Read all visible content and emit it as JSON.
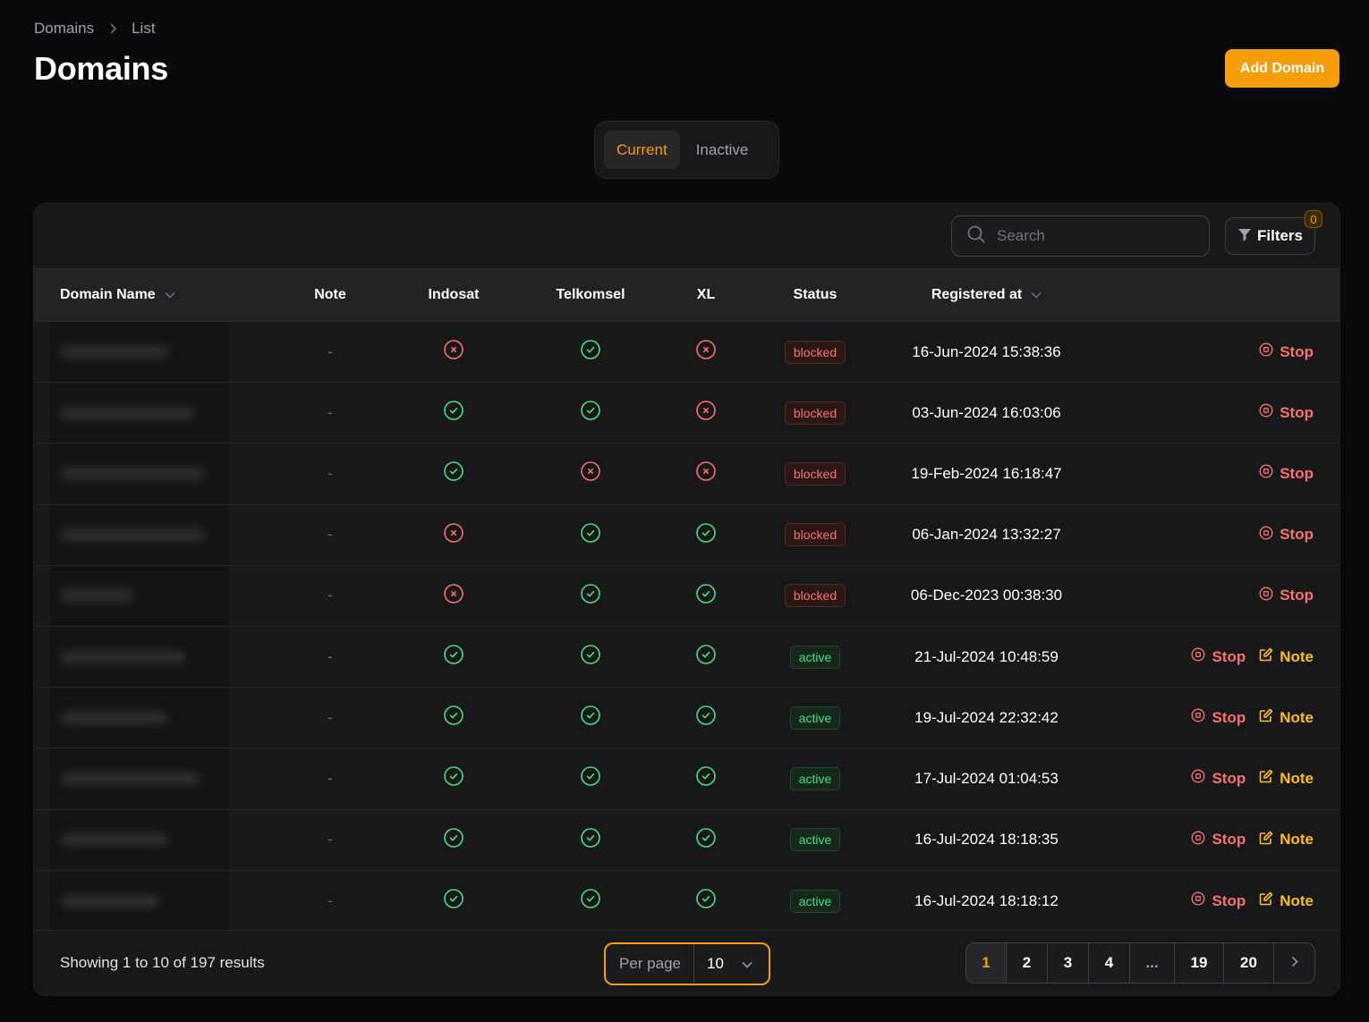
{
  "breadcrumb": {
    "items": [
      "Domains",
      "List"
    ]
  },
  "page": {
    "title": "Domains",
    "add_button": "Add Domain"
  },
  "tabs": [
    {
      "label": "Current",
      "active": true
    },
    {
      "label": "Inactive",
      "active": false
    }
  ],
  "toolbar": {
    "search_placeholder": "Search",
    "search_value": "",
    "filters_label": "Filters",
    "filters_count": "0"
  },
  "table": {
    "columns": [
      "Domain Name",
      "Note",
      "Indosat",
      "Telkomsel",
      "XL",
      "Status",
      "Registered at"
    ],
    "rows": [
      {
        "domain": "[redacted]",
        "note": "-",
        "indosat": false,
        "telkomsel": true,
        "xl": false,
        "status": "blocked",
        "registered_at": "16-Jun-2024 15:38:36",
        "actions": [
          "Stop"
        ]
      },
      {
        "domain": "[redacted]",
        "note": "-",
        "indosat": true,
        "telkomsel": true,
        "xl": false,
        "status": "blocked",
        "registered_at": "03-Jun-2024 16:03:06",
        "actions": [
          "Stop"
        ]
      },
      {
        "domain": "[redacted]",
        "note": "-",
        "indosat": true,
        "telkomsel": false,
        "xl": false,
        "status": "blocked",
        "registered_at": "19-Feb-2024 16:18:47",
        "actions": [
          "Stop"
        ]
      },
      {
        "domain": "[redacted]",
        "note": "-",
        "indosat": false,
        "telkomsel": true,
        "xl": true,
        "status": "blocked",
        "registered_at": "06-Jan-2024 13:32:27",
        "actions": [
          "Stop"
        ]
      },
      {
        "domain": "[redacted]",
        "note": "-",
        "indosat": false,
        "telkomsel": true,
        "xl": true,
        "status": "blocked",
        "registered_at": "06-Dec-2023 00:38:30",
        "actions": [
          "Stop"
        ]
      },
      {
        "domain": "[redacted]",
        "note": "-",
        "indosat": true,
        "telkomsel": true,
        "xl": true,
        "status": "active",
        "registered_at": "21-Jul-2024 10:48:59",
        "actions": [
          "Stop",
          "Note"
        ]
      },
      {
        "domain": "[redacted]",
        "note": "-",
        "indosat": true,
        "telkomsel": true,
        "xl": true,
        "status": "active",
        "registered_at": "19-Jul-2024 22:32:42",
        "actions": [
          "Stop",
          "Note"
        ]
      },
      {
        "domain": "[redacted]",
        "note": "-",
        "indosat": true,
        "telkomsel": true,
        "xl": true,
        "status": "active",
        "registered_at": "17-Jul-2024 01:04:53",
        "actions": [
          "Stop",
          "Note"
        ]
      },
      {
        "domain": "[redacted]",
        "note": "-",
        "indosat": true,
        "telkomsel": true,
        "xl": true,
        "status": "active",
        "registered_at": "16-Jul-2024 18:18:35",
        "actions": [
          "Stop",
          "Note"
        ]
      },
      {
        "domain": "[redacted]",
        "note": "-",
        "indosat": true,
        "telkomsel": true,
        "xl": true,
        "status": "active",
        "registered_at": "16-Jul-2024 18:18:12",
        "actions": [
          "Stop",
          "Note"
        ]
      }
    ]
  },
  "footer": {
    "showing": "Showing 1 to 10 of 197 results",
    "per_page_label": "Per page",
    "per_page_value": "10",
    "pages": [
      "1",
      "2",
      "3",
      "4",
      "...",
      "19",
      "20"
    ],
    "current_page": "1"
  },
  "colors": {
    "accent": "#f59e0b",
    "danger": "#f87171",
    "success": "#4ade80",
    "warning": "#fbbf24"
  }
}
